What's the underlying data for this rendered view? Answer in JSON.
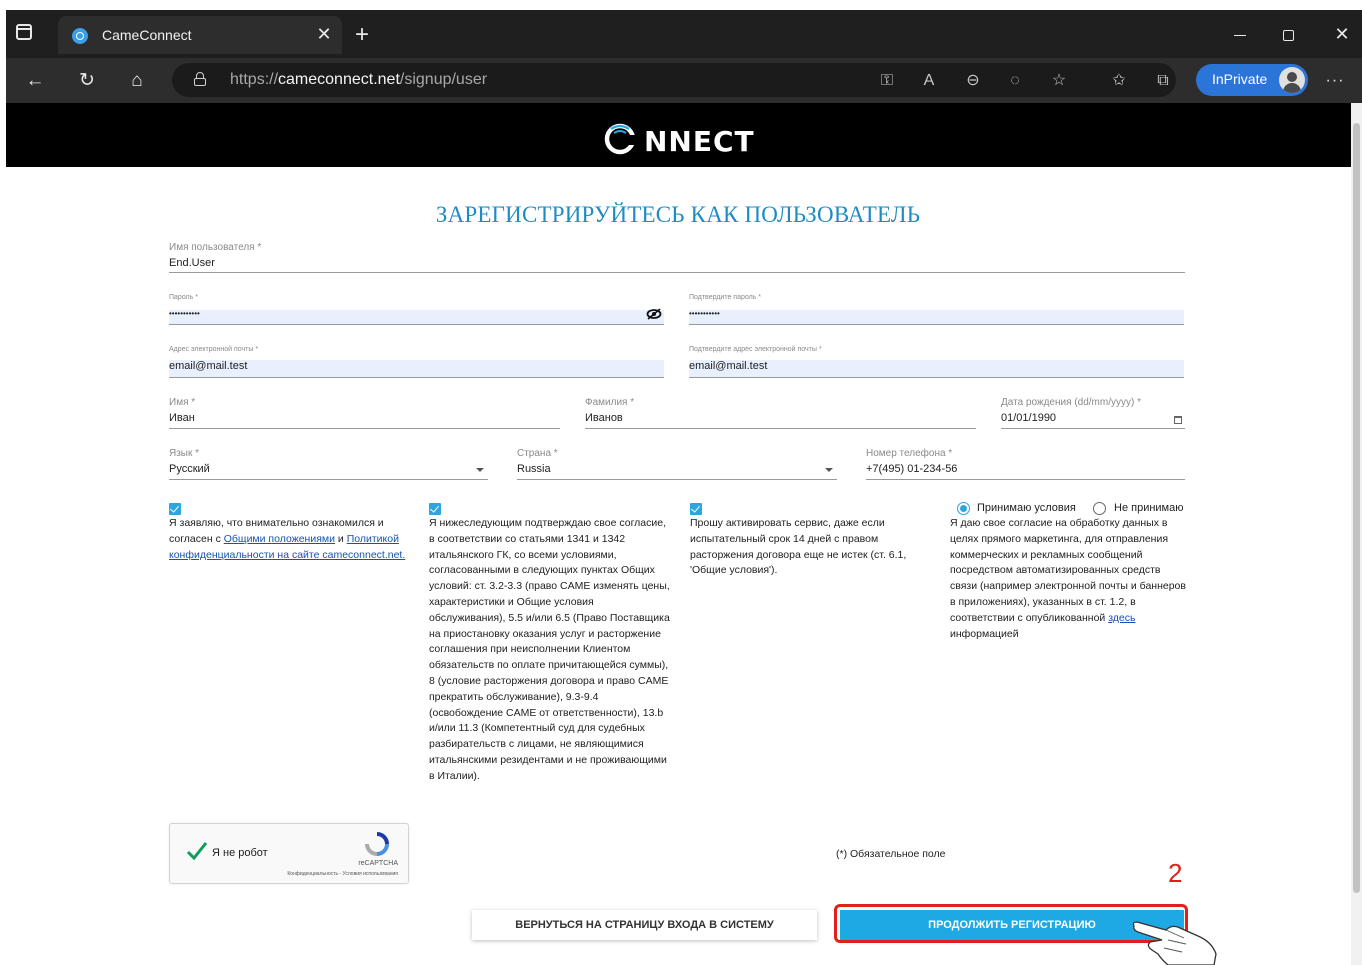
{
  "browser": {
    "tab_title": "CameConnect",
    "url_host": "cameconnect.net",
    "url_prefix": "https://",
    "url_path": "/signup/user",
    "inprivate_label": "InPrivate"
  },
  "header": {
    "logo_text": "NNECT"
  },
  "form": {
    "title": "ЗАРЕГИСТРИРУЙТЕСЬ КАК ПОЛЬЗОВАТЕЛЬ",
    "username": {
      "label": "Имя пользователя *",
      "value": "End.User"
    },
    "password": {
      "label": "Пароль *",
      "value": "•••••••••••"
    },
    "password_confirm": {
      "label": "Подтвердите пароль *",
      "value": "•••••••••••"
    },
    "email": {
      "label": "Адрес электронной почты *",
      "value": "email@mail.test"
    },
    "email_confirm": {
      "label": "Подтвердите адрес электронной почты *",
      "value": "email@mail.test"
    },
    "first_name": {
      "label": "Имя *",
      "value": "Иван"
    },
    "last_name": {
      "label": "Фамилия *",
      "value": "Иванов"
    },
    "birth_date": {
      "label": "Дата рождения (dd/mm/yyyy) *",
      "value": "01/01/1990"
    },
    "language": {
      "label": "Язык *",
      "value": "Русский"
    },
    "country": {
      "label": "Страна *",
      "value": "Russia"
    },
    "phone": {
      "label": "Номер телефона *",
      "value": "+7(495) 01-234-56"
    }
  },
  "consents": {
    "c1_text_a": "Я заявляю, что внимательно ознакомился и согласен с ",
    "c1_link1": "Общими положениями",
    "c1_text_b": " и ",
    "c1_link2": "Политикой конфиденциальности на сайте cameconnect.net.",
    "c2_text": "Я нижеследующим подтверждаю свое согласие, в соответствии со статьями 1341 и 1342 итальянского ГК, со всеми условиями, согласованными в следующих пунктах Общих условий: ст. 3.2-3.3 (право CAME изменять цены, характеристики и Общие условия обслуживания), 5.5 и/или 6.5 (Право Поставщика на приостановку оказания услуг и расторжение соглашения при неисполнении Клиентом обязательств по оплате причитающейся суммы), 8 (условие расторжения договора и право CAME прекратить обслуживание), 9.3-9.4 (освобождение CAME от ответственности), 13.b и/или 11.3 (Компетентный суд для судебных разбирательств с лицами, не являющимися итальянскими резидентами и не проживающими в Италии).",
    "c3_text": "Прошу активировать сервис, даже если испытательный срок 14 дней с правом расторжения договора еще не истек (ст. 6.1, 'Общие условия').",
    "radio_accept": "Принимаю условия",
    "radio_decline": "Не принимаю",
    "c4_text": "Я даю свое согласие на обработку данных в целях прямого маркетинга, для отправления коммерческих и рекламных сообщений посредством автоматизированных средств связи (например электронной почты и баннеров в приложениях), указанных в ст. 1.2, в соответствии с опубликованной ",
    "c4_link": "здесь",
    "c4_tail": " информацией"
  },
  "captcha": {
    "label": "Я не робот",
    "brand": "reCAPTCHA",
    "links": "Конфиденциальность - Условия использования"
  },
  "required_note": "(*) Обязательное поле",
  "buttons": {
    "back": "ВЕРНУТЬСЯ НА СТРАНИЦУ ВХОДА В СИСТЕМУ",
    "continue": "ПРОДОЛЖИТЬ РЕГИСТРАЦИЮ"
  },
  "annotation": {
    "step_number": "2"
  },
  "colors": {
    "accent": "#1ea8e4",
    "title": "#1e8bc3",
    "highlight": "#e0201b",
    "chrome_dark": "#1f1f1f",
    "inprivate": "#2b74d8"
  }
}
